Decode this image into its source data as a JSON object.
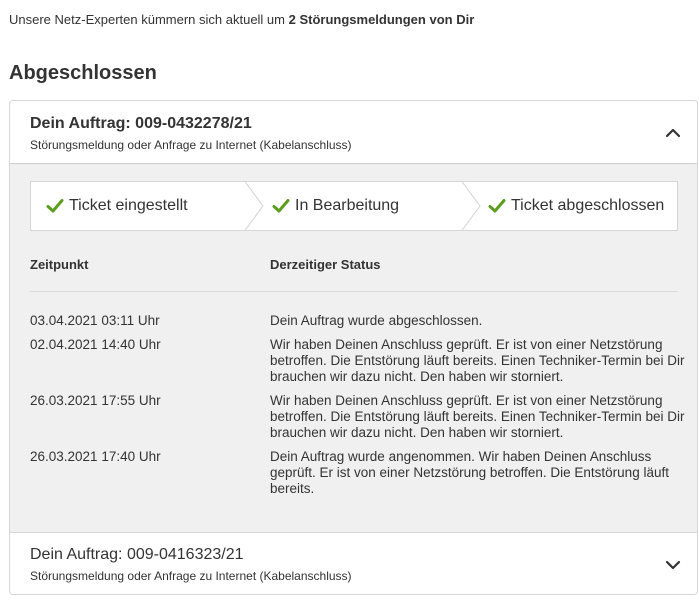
{
  "intro": {
    "prefix": "Unsere Netz-Experten kümmern sich aktuell um",
    "highlight": "2 Störungsmeldungen von Dir"
  },
  "section_title": "Abgeschlossen",
  "orders": [
    {
      "title": "Dein Auftrag: 009-0432278/21",
      "subtitle": "Störungsmeldung oder Anfrage zu Internet (Kabelanschluss)",
      "expanded": true,
      "steps": [
        {
          "label": "Ticket eingestellt",
          "done": true
        },
        {
          "label": "In Bearbeitung",
          "done": true
        },
        {
          "label": "Ticket abgeschlossen",
          "done": true
        }
      ],
      "table": {
        "col_time": "Zeitpunkt",
        "col_status": "Derzeitiger Status",
        "rows": [
          {
            "time": "03.04.2021 03:11 Uhr",
            "status": "Dein Auftrag wurde abgeschlossen."
          },
          {
            "time": "02.04.2021 14:40 Uhr",
            "status": "Wir haben Deinen Anschluss geprüft. Er ist von einer Netzstörung betroffen. Die Entstörung läuft bereits. Einen Techniker-Termin bei Dir brauchen wir dazu nicht. Den haben wir storniert."
          },
          {
            "time": "26.03.2021 17:55 Uhr",
            "status": "Wir haben Deinen Anschluss geprüft. Er ist von einer Netzstörung betroffen. Die Entstörung läuft bereits. Einen Techniker-Termin bei Dir brauchen wir dazu nicht. Den haben wir storniert."
          },
          {
            "time": "26.03.2021 17:40 Uhr",
            "status": "Dein Auftrag wurde angenommen. Wir haben Deinen Anschluss geprüft. Er ist von einer Netzstörung betroffen. Die Entstörung läuft bereits."
          }
        ]
      }
    },
    {
      "title": "Dein Auftrag: 009-0416323/21",
      "subtitle": "Störungsmeldung oder Anfrage zu Internet (Kabelanschluss)",
      "expanded": false
    }
  ],
  "colors": {
    "check": "#5b9e1f",
    "text": "#333333",
    "panel": "#f0f0f0",
    "border": "#d6d6d6"
  },
  "icons": {
    "check": "check-icon",
    "collapse": "chevron-up-icon",
    "expand": "chevron-down-icon"
  }
}
